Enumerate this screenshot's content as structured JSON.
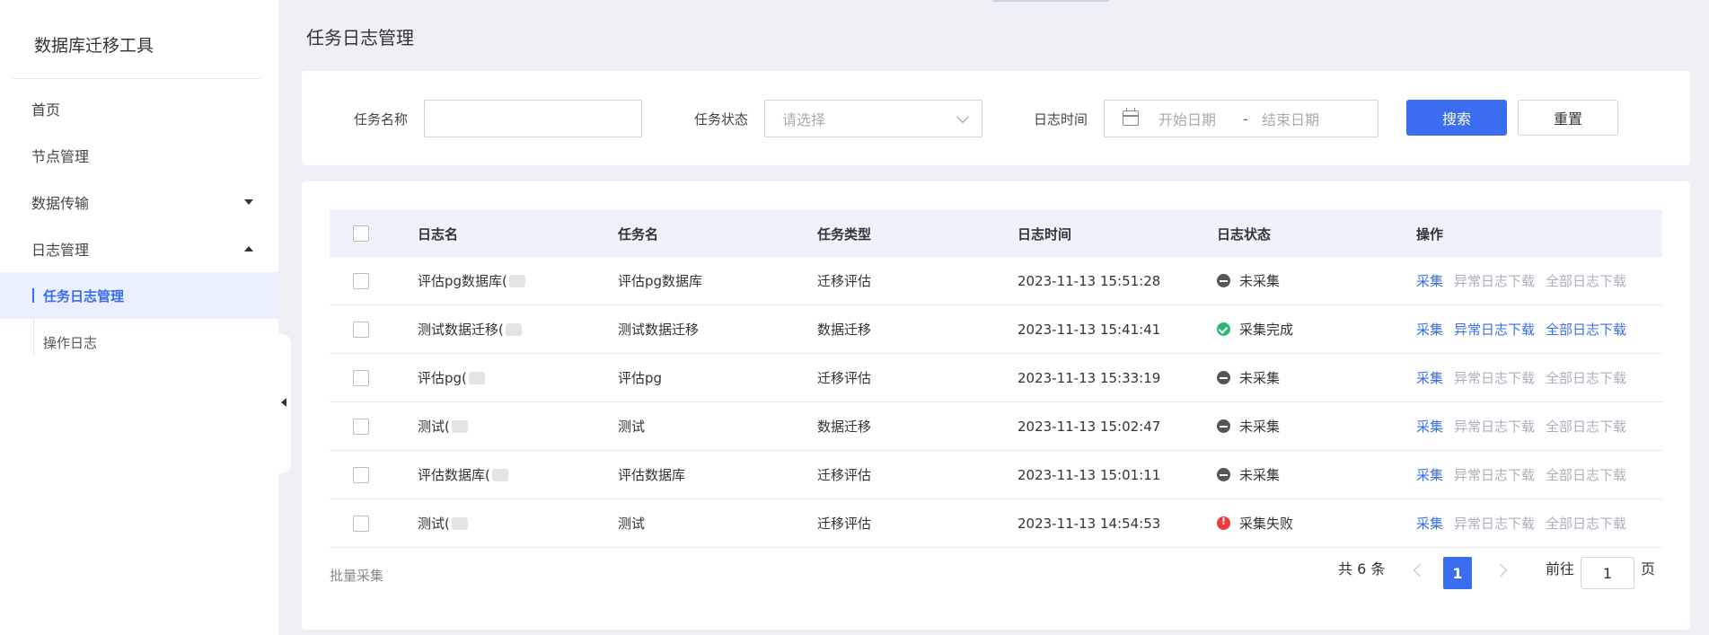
{
  "sidebar": {
    "app_title": "数据库迁移工具",
    "items": [
      {
        "label": "首页"
      },
      {
        "label": "节点管理"
      },
      {
        "label": "数据传输"
      },
      {
        "label": "日志管理"
      }
    ],
    "sub_items": [
      {
        "label": "任务日志管理"
      },
      {
        "label": "操作日志"
      }
    ]
  },
  "page": {
    "title": "任务日志管理"
  },
  "filter": {
    "task_name_label": "任务名称",
    "task_name_value": "",
    "task_status_label": "任务状态",
    "task_status_placeholder": "请选择",
    "log_time_label": "日志时间",
    "start_placeholder": "开始日期",
    "range_separator": "-",
    "end_placeholder": "结束日期",
    "search_label": "搜索",
    "reset_label": "重置"
  },
  "table": {
    "columns": [
      "日志名",
      "任务名",
      "任务类型",
      "日志时间",
      "日志状态",
      "操作"
    ],
    "rows": [
      {
        "log_name": "评估pg数据库(",
        "task_name": "评估pg数据库",
        "task_type": "迁移评估",
        "log_time": "2023-11-13 15:51:28",
        "status": "未采集",
        "status_type": "gray",
        "ops": [
          {
            "label": "采集",
            "enabled": true
          },
          {
            "label": "异常日志下载",
            "enabled": false
          },
          {
            "label": "全部日志下载",
            "enabled": false
          }
        ]
      },
      {
        "log_name": "测试数据迁移(",
        "task_name": "测试数据迁移",
        "task_type": "数据迁移",
        "log_time": "2023-11-13 15:41:41",
        "status": "采集完成",
        "status_type": "green",
        "ops": [
          {
            "label": "采集",
            "enabled": true
          },
          {
            "label": "异常日志下载",
            "enabled": true
          },
          {
            "label": "全部日志下载",
            "enabled": true
          }
        ]
      },
      {
        "log_name": "评估pg(",
        "task_name": "评估pg",
        "task_type": "迁移评估",
        "log_time": "2023-11-13 15:33:19",
        "status": "未采集",
        "status_type": "gray",
        "ops": [
          {
            "label": "采集",
            "enabled": true
          },
          {
            "label": "异常日志下载",
            "enabled": false
          },
          {
            "label": "全部日志下载",
            "enabled": false
          }
        ]
      },
      {
        "log_name": "测试(",
        "task_name": "测试",
        "task_type": "数据迁移",
        "log_time": "2023-11-13 15:02:47",
        "status": "未采集",
        "status_type": "gray",
        "ops": [
          {
            "label": "采集",
            "enabled": true
          },
          {
            "label": "异常日志下载",
            "enabled": false
          },
          {
            "label": "全部日志下载",
            "enabled": false
          }
        ]
      },
      {
        "log_name": "评估数据库(",
        "task_name": "评估数据库",
        "task_type": "迁移评估",
        "log_time": "2023-11-13 15:01:11",
        "status": "未采集",
        "status_type": "gray",
        "ops": [
          {
            "label": "采集",
            "enabled": true
          },
          {
            "label": "异常日志下载",
            "enabled": false
          },
          {
            "label": "全部日志下载",
            "enabled": false
          }
        ]
      },
      {
        "log_name": "测试(",
        "task_name": "测试",
        "task_type": "迁移评估",
        "log_time": "2023-11-13 14:54:53",
        "status": "采集失败",
        "status_type": "red",
        "ops": [
          {
            "label": "采集",
            "enabled": true
          },
          {
            "label": "异常日志下载",
            "enabled": false
          },
          {
            "label": "全部日志下载",
            "enabled": false
          }
        ]
      }
    ]
  },
  "footer": {
    "batch_label": "批量采集",
    "total_text": "共 6 条",
    "current_page": "1",
    "goto_label": "前往",
    "goto_value": "1",
    "page_suffix": "页"
  },
  "colors": {
    "accent": "#3a6df0",
    "success": "#2bb673",
    "danger": "#f0393b"
  }
}
